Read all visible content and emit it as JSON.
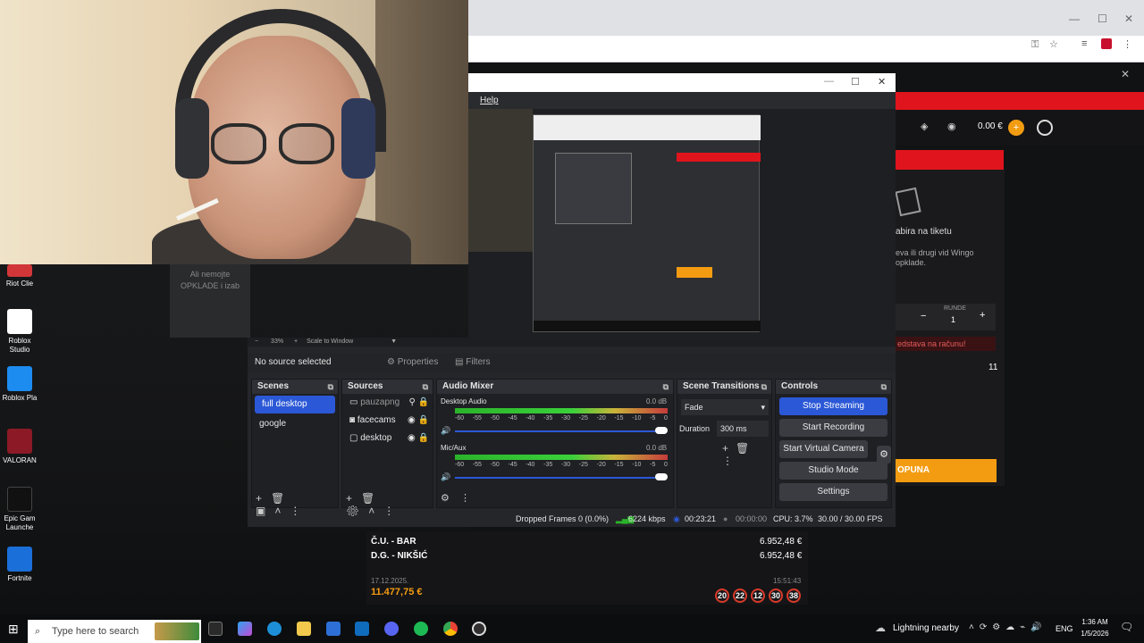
{
  "obs": {
    "menu_help": "Help",
    "no_source": "No source selected",
    "properties": "Properties",
    "filters": "Filters",
    "zoom": "33%",
    "scale_mode": "Scale to Window",
    "scenes_title": "Scenes",
    "scenes": [
      "full desktop",
      "google"
    ],
    "sources_title": "Sources",
    "sources": [
      "pauzapng",
      "facecams",
      "desktop"
    ],
    "mixer_title": "Audio Mixer",
    "desktop_audio_label": "Desktop Audio",
    "desktop_audio_db": "0.0 dB",
    "mic_label": "Mic/Aux",
    "mic_db": "0.0 dB",
    "meter_ticks": [
      "-60",
      "-55",
      "-50",
      "-45",
      "-40",
      "-35",
      "-30",
      "-25",
      "-20",
      "-15",
      "-10",
      "-5",
      "0"
    ],
    "transitions_title": "Scene Transitions",
    "transition": "Fade",
    "duration_label": "Duration",
    "duration_value": "300 ms",
    "controls_title": "Controls",
    "stop_streaming": "Stop Streaming",
    "start_recording": "Start Recording",
    "start_virtual_camera": "Start Virtual Camera",
    "studio_mode": "Studio Mode",
    "settings": "Settings",
    "status_dropped": "Dropped Frames 0 (0.0%)",
    "status_kbps": "6224 kbps",
    "status_live": "00:23:21",
    "status_rec": "00:00:00",
    "status_cpu": "CPU: 3.7%",
    "status_fps": "30.00 / 30.00 FPS"
  },
  "desktop_icons": [
    "Riot Clie",
    "Roblox Studio",
    "Roblox Pla",
    "VALORAN",
    "Epic Gam Launche",
    "Fortnite"
  ],
  "desktop_text": {
    "line1": "Ali nemojte",
    "line2": "OPKLADE i izab"
  },
  "site": {
    "balance": "0.00 €",
    "slip_text": "abira na tiketu",
    "slip_sub": "eva ili drugi vid Wingo opklade.",
    "runde_label": "RUNDE",
    "runde_value": "1",
    "warning": "edstava na računu!",
    "count": "11",
    "cta": "OPUNA"
  },
  "bets": {
    "row1_name": "Č.U. - BAR",
    "row1_amount": "6.952,48 €",
    "row2_name": "D.G. - NIKŠIĆ",
    "row2_amount": "6.952,48 €",
    "date": "17.12.2025.",
    "time": "15:51:43",
    "total": "11.477,75 €",
    "balls": [
      "20",
      "22",
      "12",
      "30",
      "38"
    ]
  },
  "taskbar": {
    "search_placeholder": "Type here to search",
    "weather": "Lightning nearby",
    "lang": "ENG",
    "clock_time": "1:36 AM",
    "clock_date": "1/5/2026"
  },
  "colors": {
    "obs_blue": "#2b58d6",
    "site_red": "#e0141c",
    "site_orange": "#f39c12"
  }
}
